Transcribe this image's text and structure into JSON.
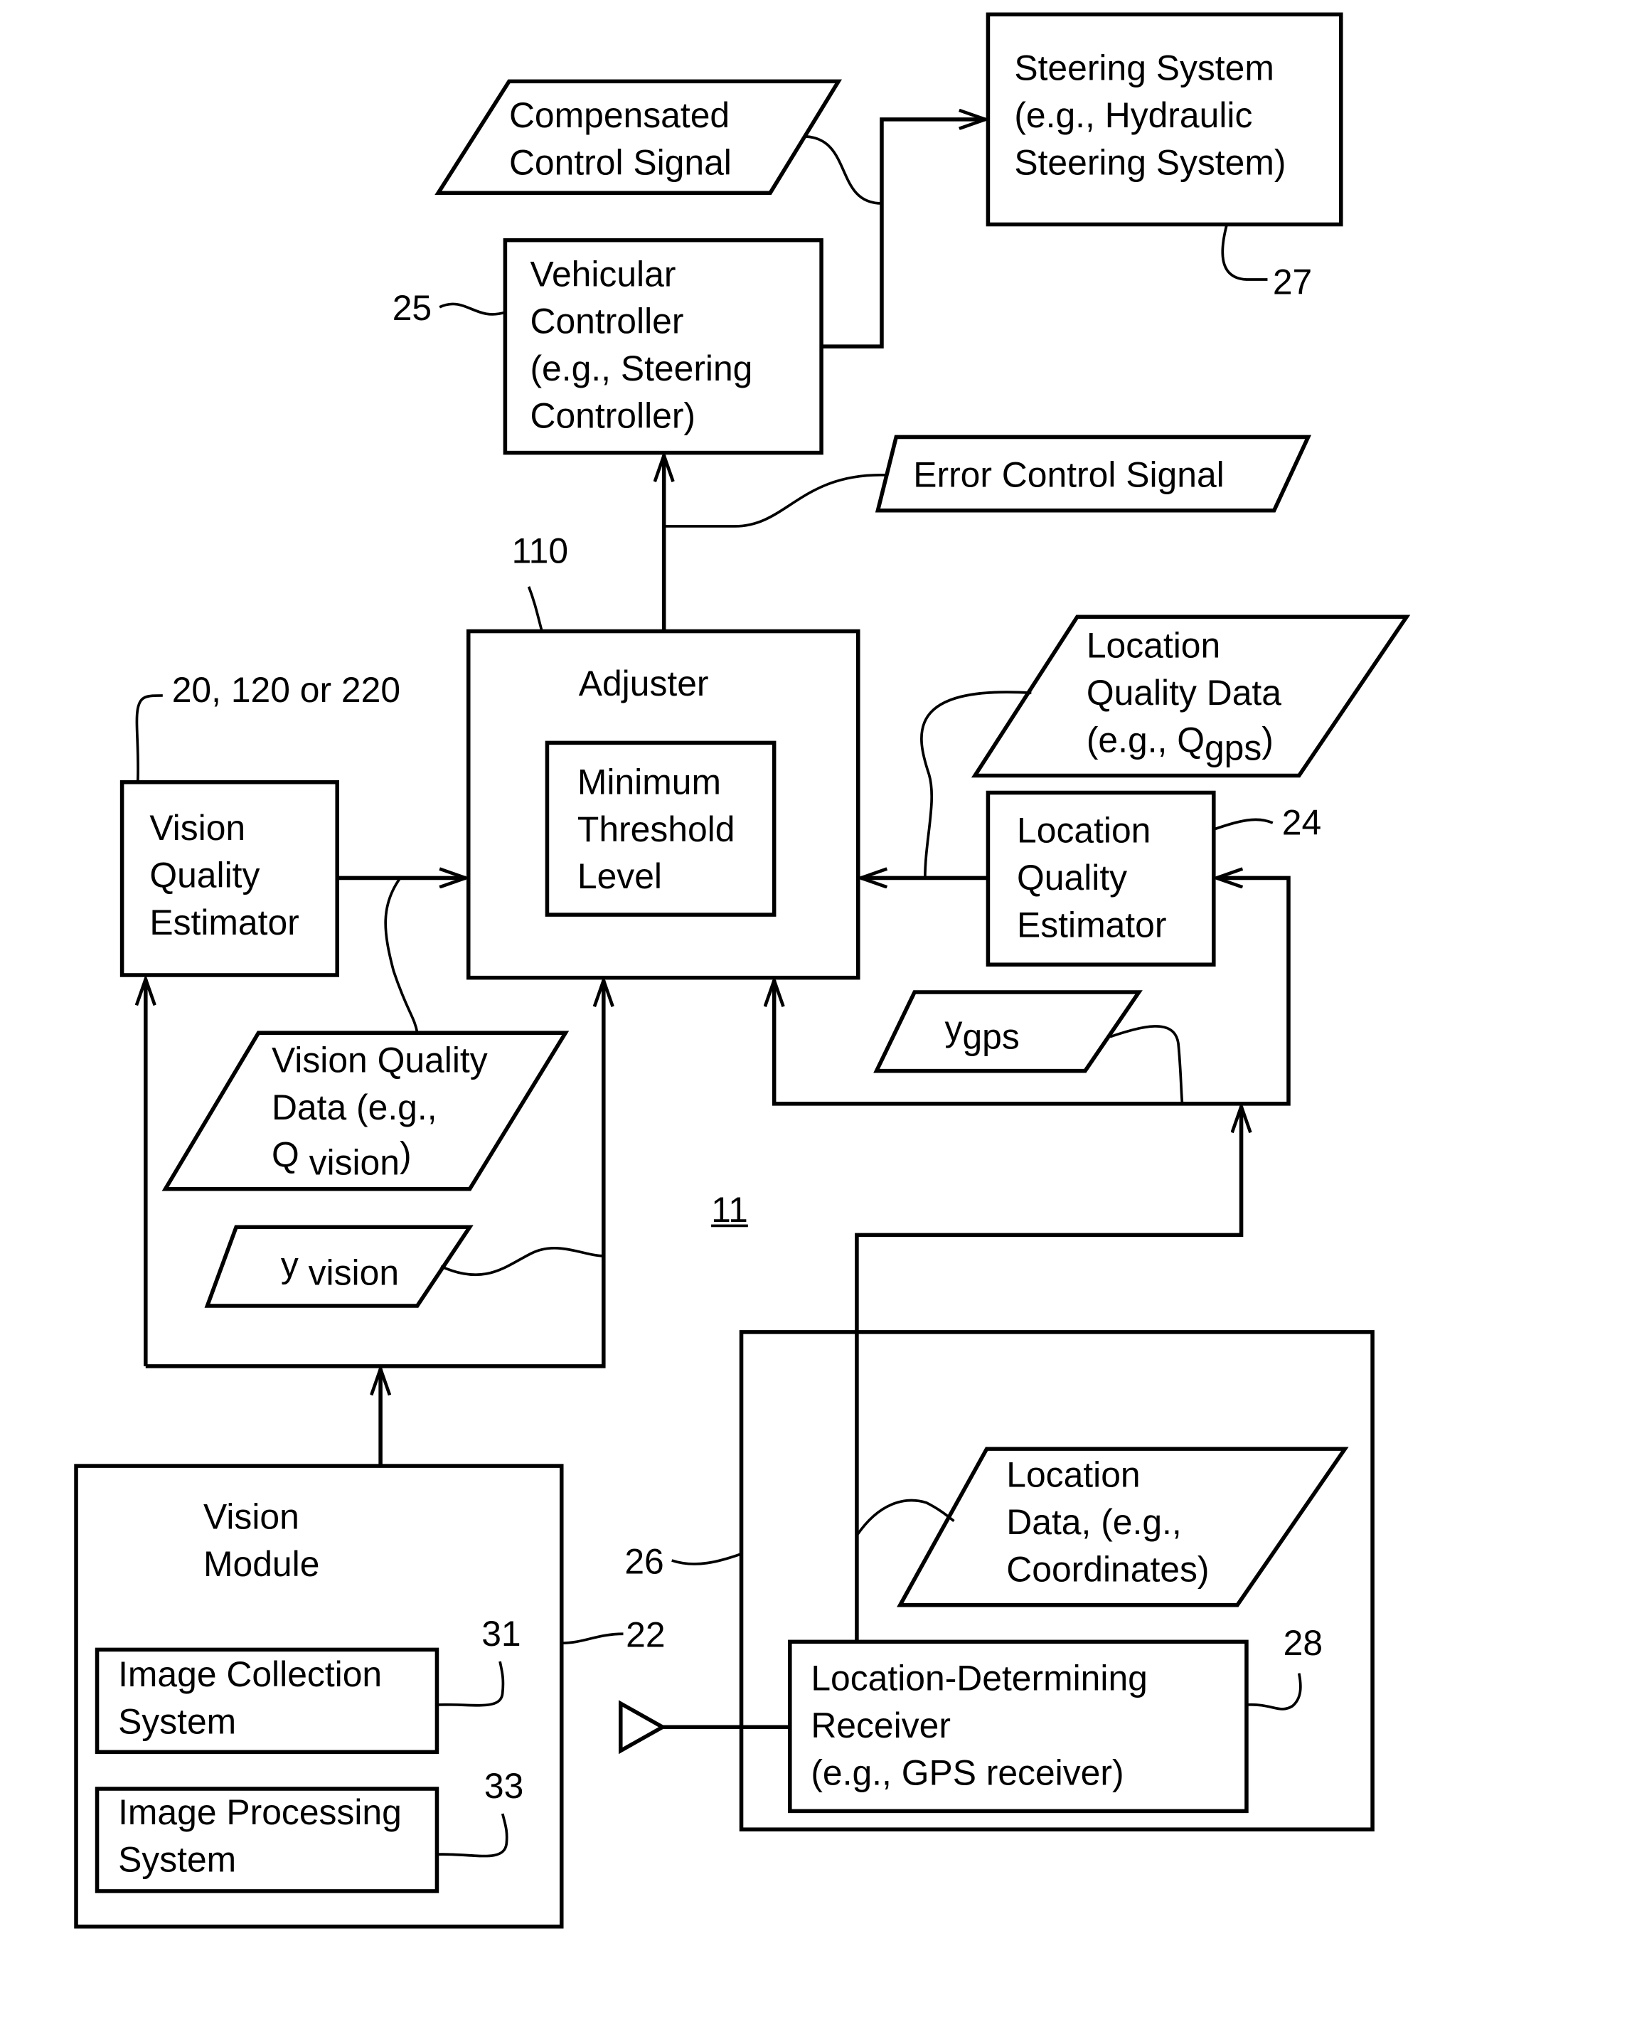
{
  "figure": {
    "reference_label": "11",
    "colors": {
      "stroke": "#000000",
      "background": "#ffffff"
    }
  },
  "blocks": {
    "steering_system": {
      "lines": [
        "Steering System",
        "(e.g., Hydraulic",
        "Steering System)"
      ],
      "ref": "27"
    },
    "vehicular_controller": {
      "lines": [
        "Vehicular",
        "Controller",
        "(e.g., Steering",
        "Controller)"
      ],
      "ref": "25"
    },
    "adjuster": {
      "title": "Adjuster",
      "ref": "110",
      "inner": {
        "lines": [
          "Minimum",
          "Threshold",
          "Level"
        ]
      }
    },
    "vision_quality_estimator": {
      "lines": [
        "Vision",
        "Quality",
        "Estimator"
      ],
      "ref": "20, 120 or 220"
    },
    "location_quality_estimator": {
      "lines": [
        "Location",
        "Quality",
        "Estimator"
      ],
      "ref": "24"
    },
    "vision_module": {
      "lines": [
        "Vision",
        "Module"
      ],
      "ref": "22",
      "image_collection": {
        "lines": [
          "Image Collection",
          "System"
        ],
        "ref": "31"
      },
      "image_processing": {
        "lines": [
          "Image Processing",
          "System"
        ],
        "ref": "33"
      }
    },
    "location_module": {
      "ref": "26",
      "receiver": {
        "lines": [
          "Location-Determining",
          "Receiver",
          "(e.g., GPS receiver)"
        ],
        "ref": "28"
      }
    }
  },
  "data_items": {
    "compensated_control_signal": {
      "lines": [
        "Compensated",
        "Control Signal"
      ]
    },
    "error_control_signal": {
      "label": "Error Control Signal"
    },
    "location_quality_data": {
      "lines": [
        "Location",
        "Quality Data"
      ],
      "eg": "(e.g., Q",
      "sub": "gps",
      "close": ")"
    },
    "vision_quality_data": {
      "lines": [
        "Vision Quality",
        "Data (e.g.,"
      ],
      "sym": "Q",
      "sub": "vision",
      "close": ")"
    },
    "y_gps": {
      "sym": "y",
      "sub": "gps"
    },
    "y_vision": {
      "sym": "y",
      "sub": "vision"
    },
    "location_data": {
      "lines": [
        "Location",
        "Data, (e.g.,",
        "Coordinates)"
      ]
    }
  },
  "icons": {
    "antenna": "antenna-triangle-icon"
  }
}
